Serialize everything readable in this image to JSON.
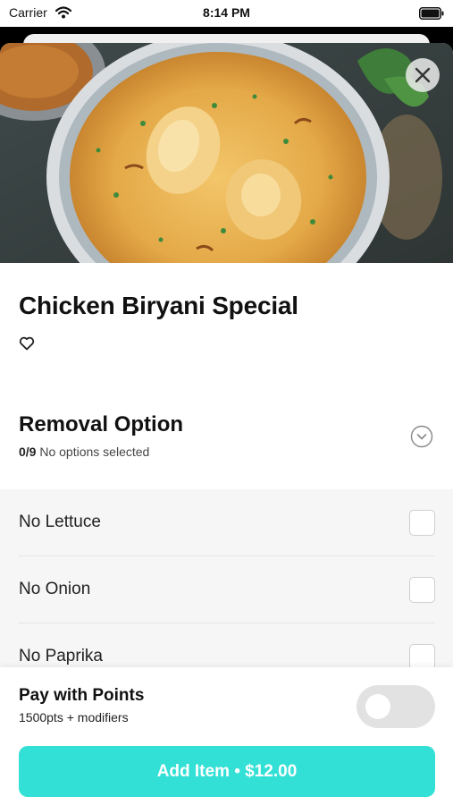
{
  "status_bar": {
    "carrier": "Carrier",
    "time": "8:14 PM"
  },
  "item": {
    "title": "Chicken Biryani Special"
  },
  "removal": {
    "title": "Removal Option",
    "count": "0/9",
    "status": "No options selected",
    "options": [
      {
        "label": "No Lettuce",
        "checked": false
      },
      {
        "label": "No Onion",
        "checked": false
      },
      {
        "label": "No Paprika",
        "checked": false
      }
    ]
  },
  "points": {
    "title": "Pay with Points",
    "subtitle": "1500pts + modifiers",
    "enabled": false
  },
  "add_button": {
    "label": "Add Item • $12.00"
  },
  "colors": {
    "accent": "#33e0d5",
    "options_bg": "#f6f6f6",
    "toggle_off": "#e2e2e2"
  },
  "icons": [
    "wifi-icon",
    "battery-icon",
    "close-icon",
    "heart-icon",
    "chevron-down-icon"
  ]
}
